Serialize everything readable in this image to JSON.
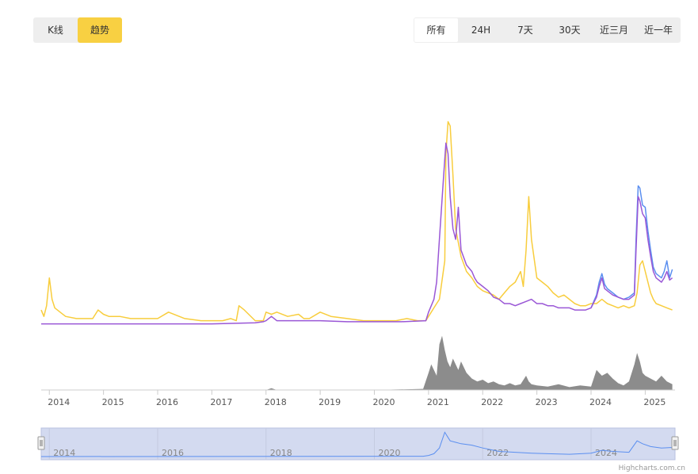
{
  "toggle": {
    "kline_label": "K线",
    "trend_label": "趋势",
    "active": "trend"
  },
  "ranges": {
    "items": [
      "所有",
      "24H",
      "7天",
      "30天",
      "近三月",
      "近一年"
    ],
    "active_index": 0
  },
  "credit": "Highcharts.com.cn",
  "colors": {
    "series_yellow": "#f8cd3d",
    "series_purple": "#9a57d6",
    "series_blue": "#5b8ff0",
    "volume": "#8c8c8c",
    "navigator_fill": "#d3daf0",
    "navigator_line": "#5b8ff0",
    "active_toggle": "#f8d042"
  },
  "chart_data": {
    "type": "line",
    "x_labels": [
      "2014",
      "2015",
      "2016",
      "2017",
      "2018",
      "2019",
      "2020",
      "2021",
      "2022",
      "2023",
      "2024",
      "2025"
    ],
    "navigator_labels": [
      "2014",
      "2016",
      "2018",
      "2020",
      "2022",
      "2024"
    ],
    "y_scale": [
      0,
      100
    ],
    "series": [
      {
        "key": "yellow",
        "x": [
          2013.85,
          2013.9,
          2013.95,
          2014.0,
          2014.05,
          2014.1,
          2014.2,
          2014.3,
          2014.5,
          2014.7,
          2014.8,
          2014.9,
          2015.0,
          2015.1,
          2015.3,
          2015.5,
          2015.7,
          2015.9,
          2016.0,
          2016.2,
          2016.5,
          2016.8,
          2017.0,
          2017.2,
          2017.35,
          2017.45,
          2017.5,
          2017.6,
          2017.8,
          2017.95,
          2018.0,
          2018.1,
          2018.2,
          2018.4,
          2018.6,
          2018.7,
          2018.8,
          2019.0,
          2019.2,
          2019.5,
          2019.8,
          2020.0,
          2020.1,
          2020.2,
          2020.4,
          2020.6,
          2020.8,
          2020.95,
          2021.0,
          2021.05,
          2021.1,
          2021.15,
          2021.2,
          2021.3,
          2021.32,
          2021.36,
          2021.4,
          2021.45,
          2021.5,
          2021.6,
          2021.7,
          2021.8,
          2021.85,
          2021.9,
          2022.0,
          2022.1,
          2022.2,
          2022.3,
          2022.4,
          2022.5,
          2022.6,
          2022.7,
          2022.75,
          2022.8,
          2022.85,
          2022.9,
          2023.0,
          2023.1,
          2023.2,
          2023.3,
          2023.4,
          2023.5,
          2023.6,
          2023.7,
          2023.8,
          2023.9,
          2024.0,
          2024.1,
          2024.2,
          2024.3,
          2024.4,
          2024.5,
          2024.6,
          2024.7,
          2024.8,
          2024.85,
          2024.9,
          2024.95,
          2025.0,
          2025.05,
          2025.1,
          2025.15,
          2025.2,
          2025.3,
          2025.4,
          2025.5
        ],
        "y": [
          7,
          4,
          9,
          22,
          12,
          8,
          6,
          4,
          3,
          3,
          3,
          7,
          5,
          4,
          4,
          3,
          3,
          3,
          3,
          6,
          3,
          2,
          2,
          2,
          3,
          2,
          9,
          7,
          2,
          2,
          6,
          5,
          6,
          4,
          5,
          3,
          3,
          6,
          4,
          3,
          2,
          2,
          2,
          2,
          2,
          3,
          2,
          2,
          4,
          6,
          8,
          10,
          12,
          30,
          80,
          95,
          93,
          70,
          45,
          32,
          25,
          22,
          20,
          18,
          16,
          15,
          14,
          12,
          15,
          18,
          20,
          25,
          18,
          35,
          60,
          40,
          22,
          20,
          18,
          15,
          13,
          14,
          12,
          10,
          9,
          9,
          10,
          10,
          12,
          10,
          9,
          8,
          9,
          8,
          9,
          15,
          28,
          30,
          25,
          20,
          15,
          12,
          10,
          9,
          8,
          7
        ]
      },
      {
        "key": "purple",
        "x": [
          2013.85,
          2014.0,
          2015.0,
          2016.0,
          2017.0,
          2017.5,
          2017.8,
          2017.95,
          2018.0,
          2018.1,
          2018.2,
          2018.5,
          2019.0,
          2019.5,
          2020.0,
          2020.5,
          2020.95,
          2021.0,
          2021.1,
          2021.15,
          2021.2,
          2021.28,
          2021.32,
          2021.36,
          2021.4,
          2021.45,
          2021.5,
          2021.55,
          2021.6,
          2021.7,
          2021.8,
          2021.85,
          2021.9,
          2022.0,
          2022.1,
          2022.2,
          2022.3,
          2022.4,
          2022.5,
          2022.6,
          2022.7,
          2022.8,
          2022.9,
          2023.0,
          2023.1,
          2023.2,
          2023.3,
          2023.4,
          2023.5,
          2023.6,
          2023.7,
          2023.8,
          2023.9,
          2024.0,
          2024.1,
          2024.15,
          2024.2,
          2024.25,
          2024.3,
          2024.4,
          2024.5,
          2024.6,
          2024.7,
          2024.8,
          2024.83,
          2024.87,
          2024.9,
          2024.95,
          2025.0,
          2025.05,
          2025.1,
          2025.15,
          2025.2,
          2025.3,
          2025.35,
          2025.4,
          2025.45,
          2025.5
        ],
        "y": [
          0.5,
          0.5,
          0.5,
          0.5,
          0.5,
          0.8,
          1,
          1.5,
          2,
          4,
          2,
          2,
          2,
          1.5,
          1.5,
          1.5,
          2,
          6,
          12,
          20,
          40,
          70,
          85,
          80,
          60,
          45,
          40,
          55,
          35,
          28,
          25,
          22,
          20,
          18,
          16,
          13,
          12,
          10,
          10,
          9,
          10,
          11,
          12,
          10,
          10,
          9,
          9,
          8,
          8,
          8,
          7,
          7,
          7,
          8,
          13,
          18,
          22,
          17,
          16,
          14,
          13,
          12,
          12,
          14,
          35,
          60,
          58,
          52,
          50,
          40,
          32,
          25,
          22,
          20,
          22,
          25,
          21,
          22
        ]
      },
      {
        "key": "blue",
        "x": [
          2024.0,
          2024.1,
          2024.15,
          2024.2,
          2024.25,
          2024.3,
          2024.4,
          2024.5,
          2024.6,
          2024.7,
          2024.8,
          2024.83,
          2024.87,
          2024.9,
          2024.95,
          2025.0,
          2025.05,
          2025.1,
          2025.15,
          2025.2,
          2025.3,
          2025.35,
          2025.4,
          2025.45,
          2025.5
        ],
        "y": [
          8,
          14,
          20,
          24,
          19,
          17,
          15,
          13,
          12,
          13,
          15,
          40,
          65,
          64,
          56,
          55,
          44,
          35,
          27,
          24,
          22,
          25,
          30,
          22,
          26
        ]
      }
    ],
    "volume": {
      "x": [
        2013.85,
        2018.0,
        2018.1,
        2018.2,
        2020.0,
        2020.9,
        2021.0,
        2021.05,
        2021.1,
        2021.15,
        2021.2,
        2021.25,
        2021.3,
        2021.35,
        2021.4,
        2021.45,
        2021.5,
        2021.55,
        2021.6,
        2021.7,
        2021.8,
        2021.9,
        2022.0,
        2022.1,
        2022.2,
        2022.3,
        2022.4,
        2022.5,
        2022.6,
        2022.7,
        2022.8,
        2022.85,
        2022.9,
        2023.0,
        2023.2,
        2023.4,
        2023.6,
        2023.8,
        2024.0,
        2024.1,
        2024.2,
        2024.3,
        2024.4,
        2024.5,
        2024.6,
        2024.7,
        2024.8,
        2024.85,
        2024.9,
        2024.95,
        2025.0,
        2025.1,
        2025.2,
        2025.3,
        2025.4,
        2025.5
      ],
      "y": [
        0,
        0,
        3,
        0,
        0,
        2,
        30,
        45,
        35,
        25,
        80,
        95,
        70,
        50,
        40,
        55,
        45,
        35,
        50,
        30,
        20,
        15,
        18,
        12,
        15,
        10,
        8,
        12,
        8,
        10,
        25,
        15,
        10,
        8,
        6,
        10,
        5,
        8,
        6,
        35,
        25,
        30,
        20,
        12,
        8,
        15,
        45,
        65,
        50,
        30,
        25,
        20,
        15,
        25,
        15,
        10
      ]
    },
    "navigator": {
      "x": [
        2013.85,
        2020.9,
        2021.0,
        2021.1,
        2021.2,
        2021.3,
        2021.35,
        2021.4,
        2021.5,
        2021.6,
        2021.8,
        2022.0,
        2022.3,
        2022.6,
        2022.9,
        2023.2,
        2023.6,
        2024.0,
        2024.2,
        2024.4,
        2024.7,
        2024.85,
        2024.95,
        2025.1,
        2025.3,
        2025.5
      ],
      "y": [
        0,
        1,
        4,
        10,
        30,
        85,
        70,
        55,
        50,
        45,
        40,
        30,
        18,
        15,
        12,
        10,
        8,
        12,
        22,
        18,
        15,
        55,
        45,
        35,
        30,
        32
      ]
    },
    "ylim": [
      0,
      100
    ],
    "grid": false
  }
}
